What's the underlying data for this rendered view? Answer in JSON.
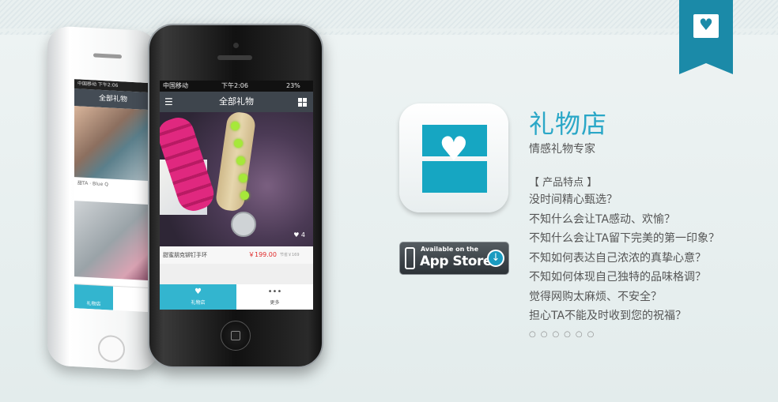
{
  "colors": {
    "accent": "#2aa7c7",
    "ribbon": "#1b8aa8",
    "tab_active": "#33b5cf",
    "price": "#e02a2a"
  },
  "ribbon": {
    "icon": "heart-box-icon"
  },
  "back_phone": {
    "status": "中国移动 下午2:06",
    "nav_title": "全部礼物",
    "caption": "甜TA · Blue Q",
    "tab_label": "礼物店"
  },
  "front_phone": {
    "status": {
      "carrier": "中国移动",
      "time": "下午2:06",
      "battery": "23%"
    },
    "nav_title": "全部礼物",
    "likes": "4",
    "product_name": "甜蜜朋克铆钉手环",
    "price": "￥199.00",
    "original_price": "节省￥169",
    "tabs": [
      {
        "label": "礼物店",
        "icon": "gift-box-icon",
        "active": true
      },
      {
        "label": "更多",
        "icon": "more-icon",
        "active": false
      }
    ]
  },
  "app": {
    "title": "礼物店",
    "subtitle": "情感礼物专家",
    "features_heading": "【 产品特点 】",
    "features": [
      "没时间精心甄选？",
      "不知什么会让TA感动、欢愉？",
      "不知什么会让TA留下完美的第一印象？",
      "不知如何表达自己浓浓的真挚心意？",
      "不知如何体现自己独特的品味格调？",
      "觉得网购太麻烦、不安全？",
      "担心TA不能及时收到您的祝福？"
    ],
    "dots": "○○○○○○"
  },
  "app_store_badge": {
    "line1": "Available on the",
    "line2": "App Store"
  }
}
